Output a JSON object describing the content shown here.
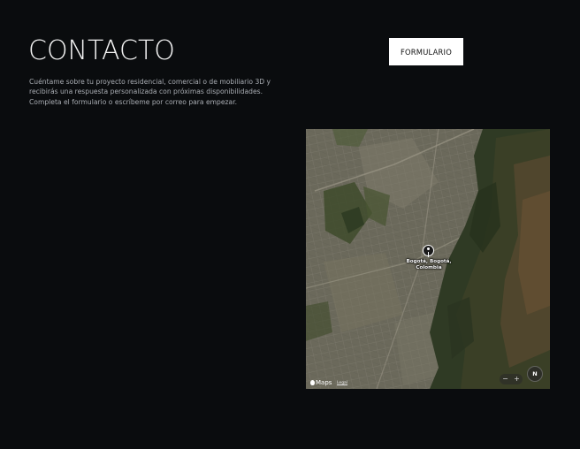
{
  "header": {
    "title": "CONTACTO",
    "description_lines": [
      "Cuéntame sobre tu proyecto residencial, comercial o de mobiliario 3D y",
      "recibirás una respuesta personalizada con próximas disponibilidades.",
      "Completa el formulario o escríbeme por correo para empezar."
    ]
  },
  "actions": {
    "form_button_label": "FORMULARIO"
  },
  "map": {
    "location_label_lines": [
      "Bogotá, Bogotá,",
      "Colombia"
    ],
    "provider_label": "Maps",
    "legal_label": "Legal",
    "zoom_out": "−",
    "zoom_in": "+",
    "compass_label": "N",
    "icons": [
      "location-pin-icon",
      "apple-logo-icon",
      "compass-icon"
    ]
  },
  "colors": {
    "background": "#0a0c0e",
    "title": "#f4f4f4",
    "body_text": "#a9adb3",
    "button_bg": "#ffffff",
    "button_text": "#111111"
  }
}
